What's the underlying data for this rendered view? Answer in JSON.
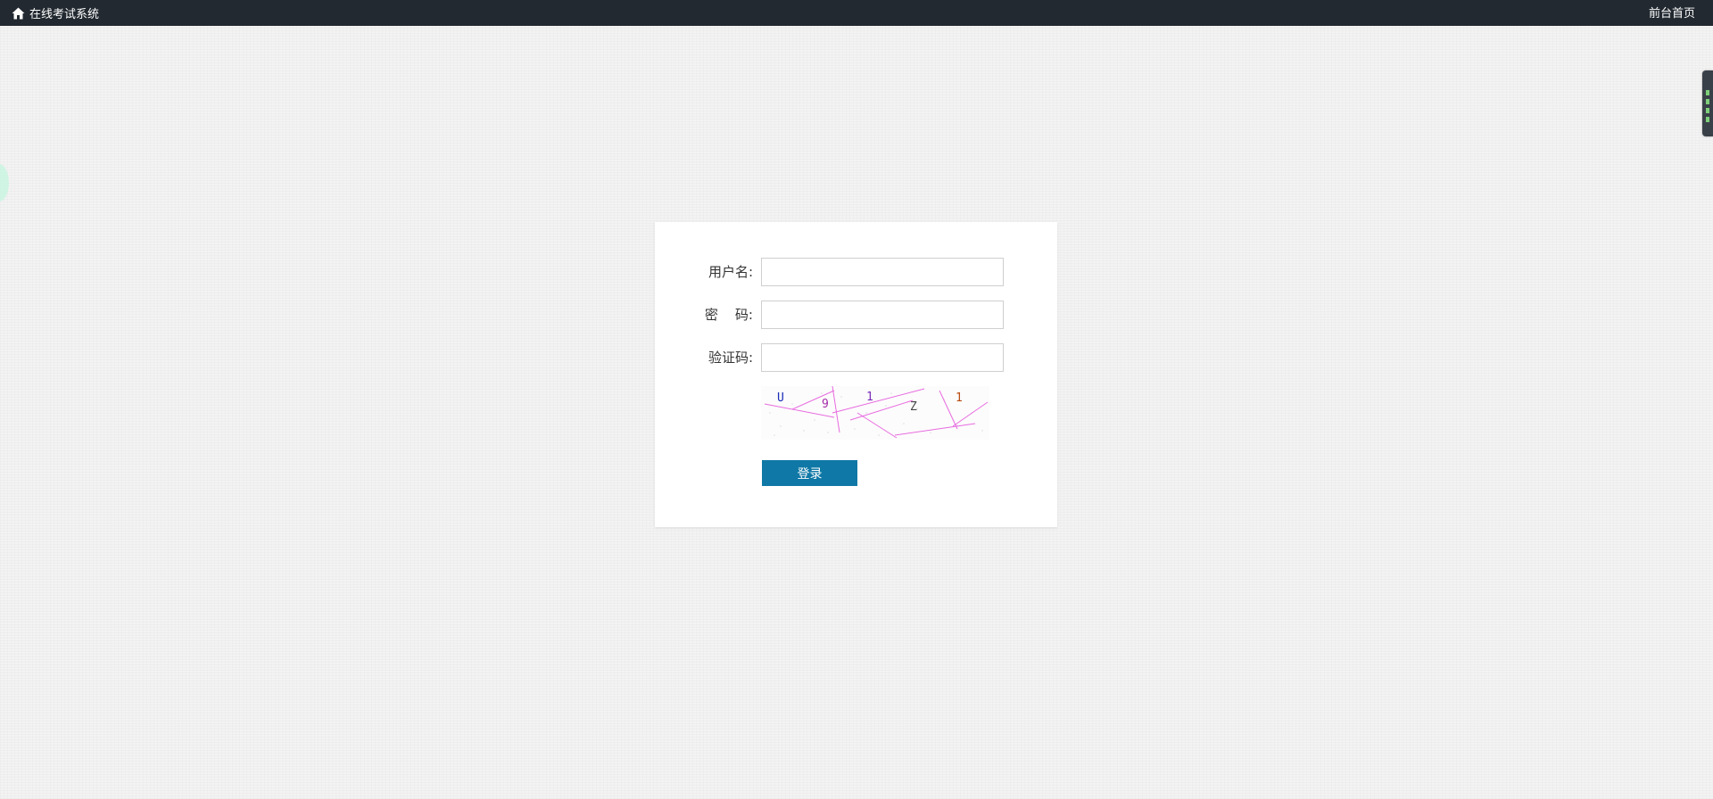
{
  "header": {
    "brand_icon": "home-icon",
    "brand_title": "在线考试系统",
    "home_link": "前台首页",
    "background_color": "#222930"
  },
  "login_form": {
    "username_label": "用户名:",
    "password_label": "密    码:",
    "captcha_label": "验证码:",
    "username_value": "",
    "password_value": "",
    "captcha_value": "",
    "captcha_image_text": [
      "U",
      "9",
      "1",
      "Z",
      "1"
    ],
    "submit_label": "登录",
    "submit_color": "#0f78a6"
  }
}
